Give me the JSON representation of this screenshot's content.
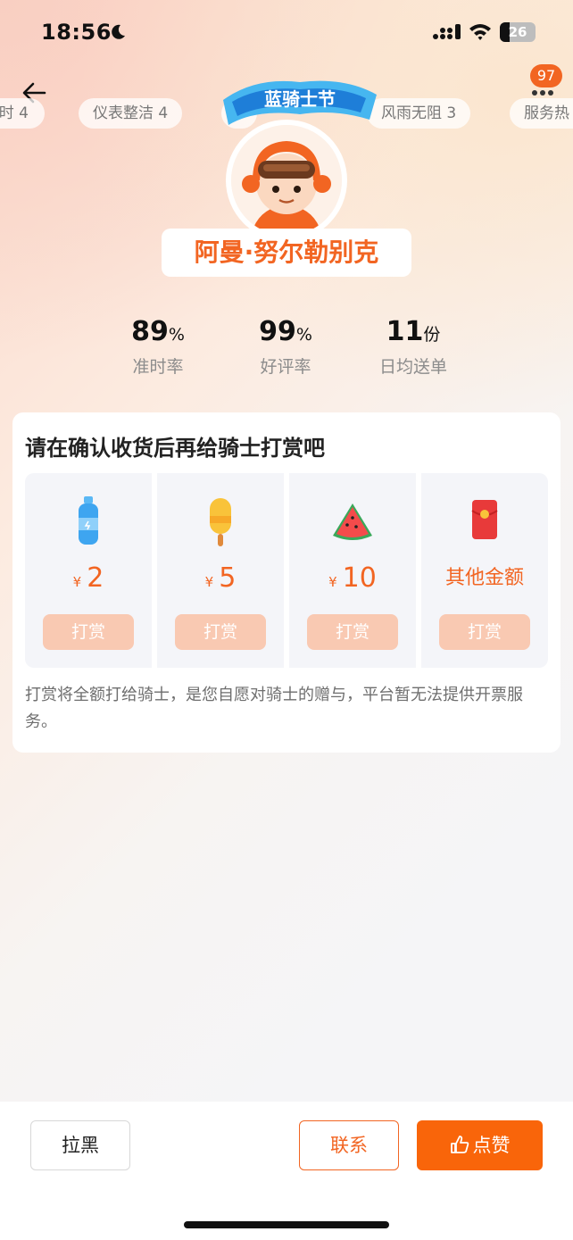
{
  "status_bar": {
    "time": "18:56",
    "battery_level": "26"
  },
  "nav": {
    "more_badge": "97"
  },
  "tags": [
    "时 4",
    "仪表整洁 4",
    "风雨无阻 3",
    "服务热"
  ],
  "rider": {
    "name": "阿曼·努尔勒别克",
    "banner_text": "蓝骑士节"
  },
  "stats": [
    {
      "value": "89",
      "unit": "%",
      "label": "准时率"
    },
    {
      "value": "99",
      "unit": "%",
      "label": "好评率"
    },
    {
      "value": "11",
      "unit": "份",
      "label": "日均送单"
    }
  ],
  "reward_card": {
    "title": "请在确认收货后再给骑士打赏吧",
    "currency": "¥",
    "options": [
      {
        "icon": "water-bottle-icon",
        "amount": "2",
        "button": "打赏"
      },
      {
        "icon": "popsicle-icon",
        "amount": "5",
        "button": "打赏"
      },
      {
        "icon": "watermelon-icon",
        "amount": "10",
        "button": "打赏"
      },
      {
        "icon": "red-envelope-icon",
        "amount_text": "其他金额",
        "button": "打赏"
      }
    ],
    "note": "打赏将全额打给骑士，是您自愿对骑士的赠与，平台暂无法提供开票服务。"
  },
  "bottom_bar": {
    "block_label": "拉黑",
    "contact_label": "联系",
    "like_label": "点赞"
  },
  "colors": {
    "accent": "#f26522",
    "tip_button": "#f9c9b2",
    "like_button": "#f9650a"
  }
}
